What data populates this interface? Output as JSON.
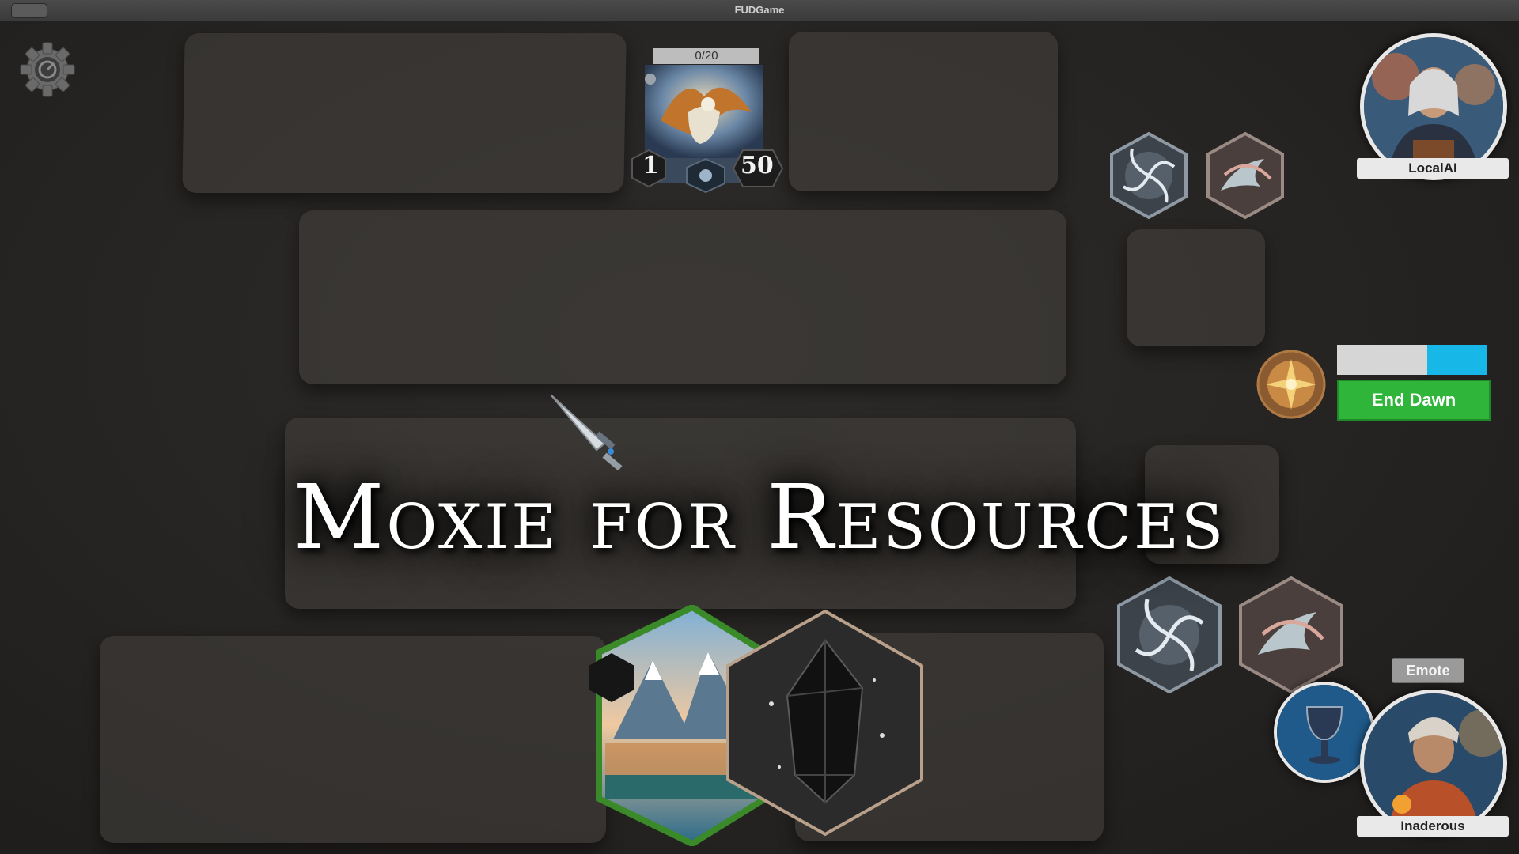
{
  "window": {
    "title": "FUDGame"
  },
  "opponent": {
    "name": "LocalAI",
    "card": {
      "counter": "0/20",
      "left_stat": "1",
      "right_stat": "50"
    }
  },
  "player": {
    "name": "Inaderous",
    "emote_label": "Emote"
  },
  "turn": {
    "end_label": "End Dawn",
    "progress": 0.6
  },
  "banner": {
    "text": "Moxie for Resources"
  },
  "icons": {
    "settings": "gear-icon",
    "opponent_tiles": [
      "vortex-tile-icon",
      "swirl-tile-icon"
    ],
    "player_tiles": [
      "vortex-tile-icon",
      "swirl-tile-icon"
    ],
    "turn_emblem": "compass-emblem-icon",
    "chalice": "chalice-icon"
  },
  "hand": [
    {
      "name": "mountain-lake-card"
    },
    {
      "name": "obsidian-crystal-card"
    }
  ],
  "colors": {
    "end_button": "#2fb53a",
    "resource_bar": "#17b7e8"
  }
}
